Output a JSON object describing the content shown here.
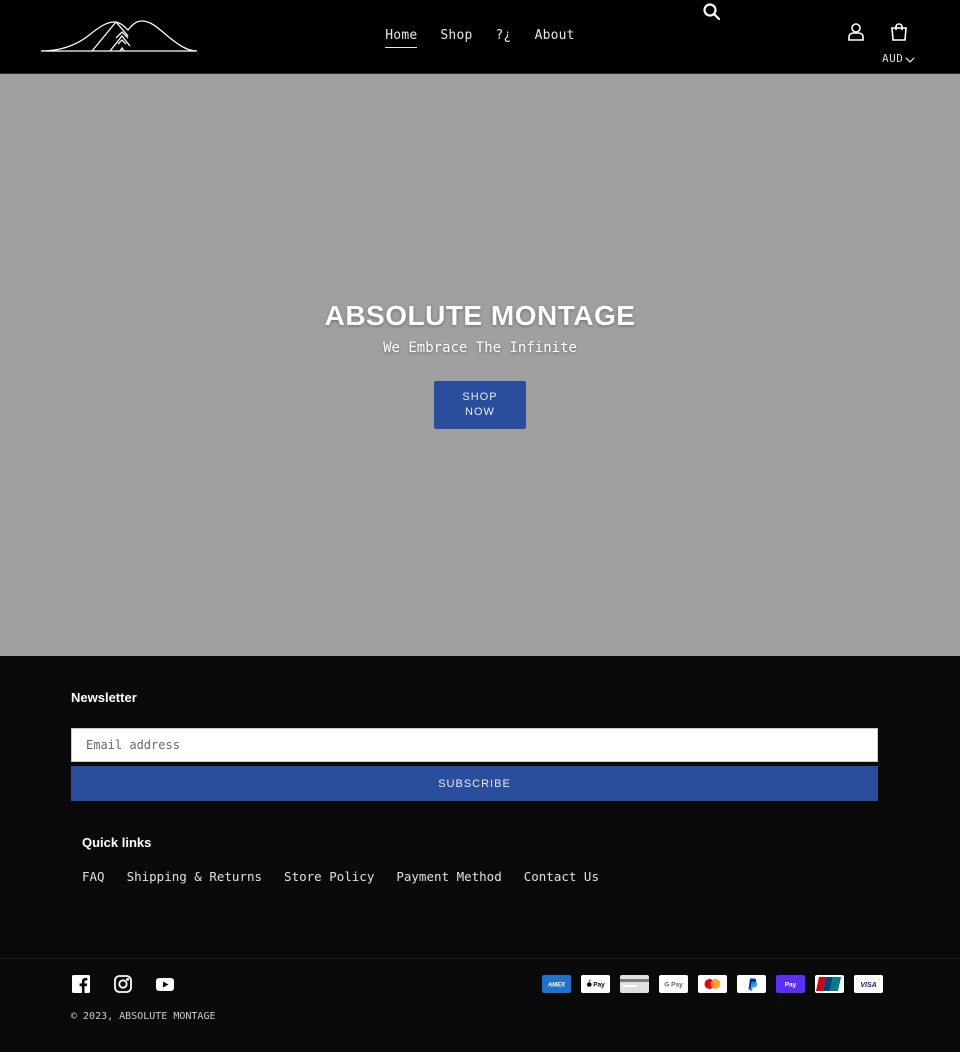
{
  "header": {
    "nav": [
      {
        "label": "Home",
        "active": true
      },
      {
        "label": "Shop",
        "active": false
      },
      {
        "label": "?¿",
        "active": false
      },
      {
        "label": "About",
        "active": false
      }
    ],
    "currency": "AUD",
    "icons": {
      "search": "search-icon",
      "account": "user-icon",
      "cart": "cart-icon",
      "logo": "mountain-logo"
    }
  },
  "hero": {
    "title": "ABSOLUTE MONTAGE",
    "subtitle": "We Embrace The Infinite",
    "button_label": "SHOP NOW",
    "background": "#a0a0a0"
  },
  "footer": {
    "newsletter_title": "Newsletter",
    "email_placeholder": "Email address",
    "subscribe_label": "SUBSCRIBE",
    "quick_links_title": "Quick links",
    "quick_links": [
      "FAQ",
      "Shipping & Returns",
      "Store Policy",
      "Payment Method",
      "Contact Us"
    ],
    "socials": [
      "facebook-icon",
      "instagram-icon",
      "youtube-icon"
    ],
    "copyright": "© 2023, ABSOLUTE MONTAGE",
    "payments": [
      {
        "name": "amex",
        "color": "#1f72cd"
      },
      {
        "name": "apple-pay",
        "color": "#ffffff"
      },
      {
        "name": "generic-card",
        "color": "#e0e0e0"
      },
      {
        "name": "google-pay",
        "color": "#ffffff"
      },
      {
        "name": "mastercard",
        "color": "#ffffff"
      },
      {
        "name": "paypal",
        "color": "#ffffff"
      },
      {
        "name": "shop-pay",
        "color": "#5a31f4"
      },
      {
        "name": "union-pay",
        "color": "#d0000c"
      },
      {
        "name": "visa",
        "color": "#ffffff"
      }
    ]
  },
  "colors": {
    "accent": "#2a4d9e",
    "header_bg": "#000000",
    "footer_bg": "#0a0a0a"
  }
}
